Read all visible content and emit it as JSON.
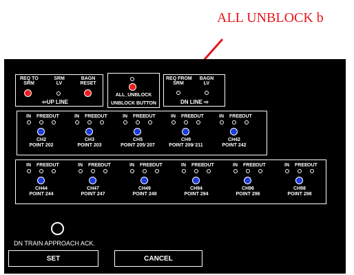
{
  "callout": {
    "text": "ALL UNBLOCK b",
    "color": "#e8141b"
  },
  "up_line": {
    "columns": [
      {
        "label": "REQ TO\nSRM",
        "indicator": "red-led"
      },
      {
        "label": "SRM\nLV",
        "indicator": "hole"
      },
      {
        "label": "BAGN\nRESET",
        "indicator": "red-led"
      }
    ],
    "caption": "⇦UP LINE"
  },
  "unblock": {
    "label": "ALL_UNBLOCK",
    "caption": "UNBLOCK BUTTON"
  },
  "dn_line": {
    "columns": [
      {
        "label": "REQ FROM\nSRM",
        "indicator": "hole"
      },
      {
        "label": "BAGN\nLV",
        "indicator": "hole"
      }
    ],
    "caption": "DN LINE ⇨"
  },
  "indicator_labels": {
    "in": "IN",
    "free": "FREE",
    "out": "OUT"
  },
  "points_row1": [
    {
      "channel": "CH2",
      "point": "POINT 202"
    },
    {
      "channel": "CH3",
      "point": "POINT 203"
    },
    {
      "channel": "CH5",
      "point": "POINT 205⁄ 207"
    },
    {
      "channel": "CH9",
      "point": "POINT 209⁄ 211"
    },
    {
      "channel": "CH42",
      "point": "POINT 242"
    }
  ],
  "points_row2": [
    {
      "channel": "CH44",
      "point": "POINT 244"
    },
    {
      "channel": "CH47",
      "point": "POINT 247"
    },
    {
      "channel": "CH49",
      "point": "POINT 249"
    },
    {
      "channel": "CH94",
      "point": "POINT 294"
    },
    {
      "channel": "CH96",
      "point": "POINT 296"
    },
    {
      "channel": "CH98",
      "point": "POINT 298"
    }
  ],
  "approach_label": "DN TRAIN APPROACH ACK.",
  "buttons": {
    "set": "SET",
    "cancel": "CANCEL"
  },
  "colors": {
    "panel": "#000000",
    "led_red": "#ee1c1c",
    "led_blue": "#1e3bd8"
  }
}
